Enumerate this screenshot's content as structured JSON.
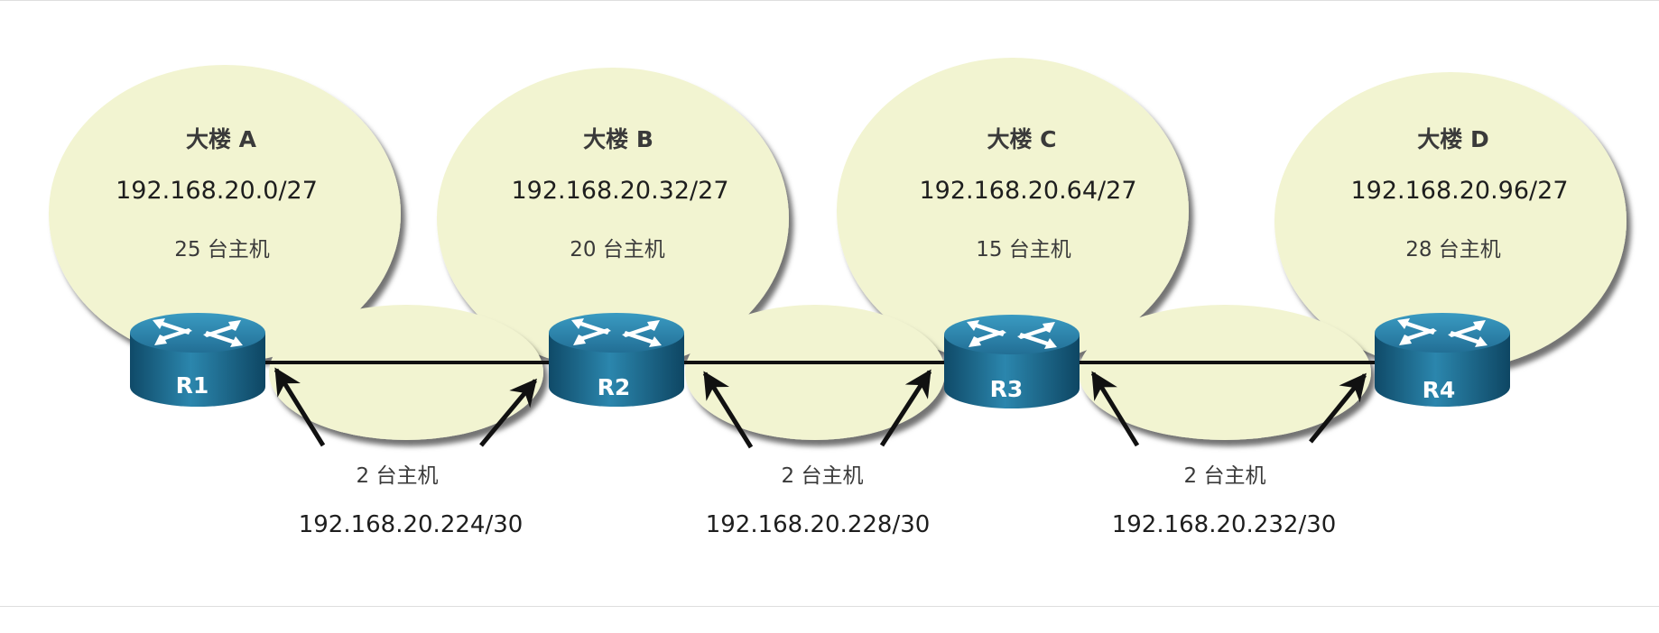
{
  "buildings": [
    {
      "name": "大楼 A",
      "subnet": "192.168.20.0/27",
      "hosts": "25 台主机"
    },
    {
      "name": "大楼 B",
      "subnet": "192.168.20.32/27",
      "hosts": "20 台主机"
    },
    {
      "name": "大楼 C",
      "subnet": "192.168.20.64/27",
      "hosts": "15 台主机"
    },
    {
      "name": "大楼 D",
      "subnet": "192.168.20.96/27",
      "hosts": "28 台主机"
    }
  ],
  "routers": [
    {
      "name": "R1"
    },
    {
      "name": "R2"
    },
    {
      "name": "R3"
    },
    {
      "name": "R4"
    }
  ],
  "links": [
    {
      "hosts": "2 台主机",
      "subnet": "192.168.20.224/30"
    },
    {
      "hosts": "2 台主机",
      "subnet": "192.168.20.228/30"
    },
    {
      "hosts": "2 台主机",
      "subnet": "192.168.20.232/30"
    }
  ],
  "colors": {
    "zone_fill": "#f2f4d1",
    "router_body": "#1c6d94",
    "router_top": "#2f8db5",
    "line": "#111111"
  }
}
